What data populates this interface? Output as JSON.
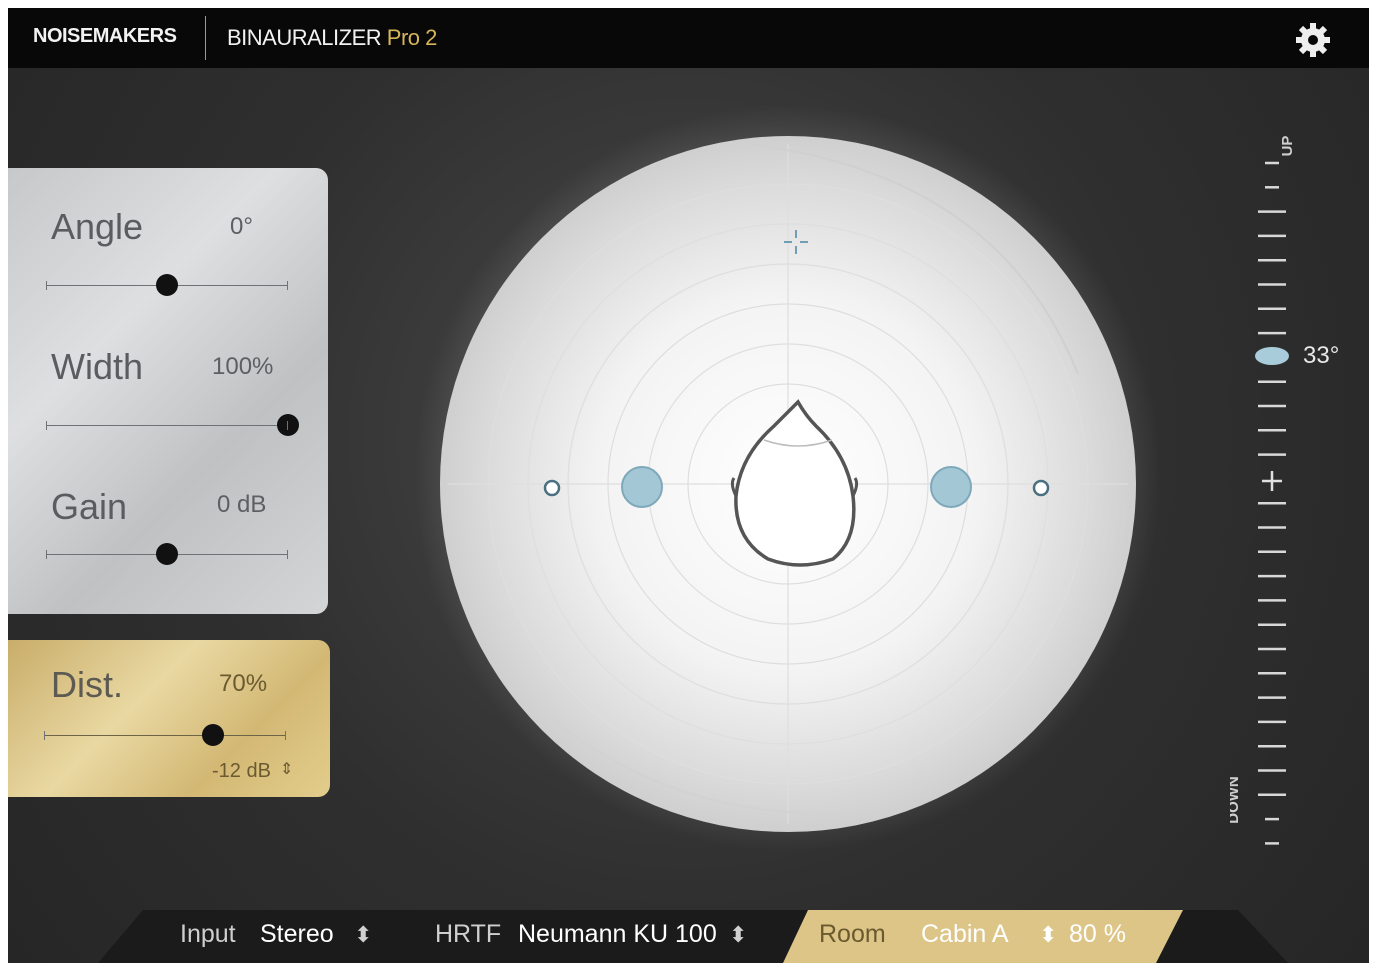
{
  "header": {
    "brand": "NOISEMAKERS",
    "product": "BINAURALIZER",
    "product_suffix": "Pro 2",
    "settings_icon": "gear-icon"
  },
  "controls": [
    {
      "label": "Angle",
      "value": "0°",
      "position": 0.5
    },
    {
      "label": "Width",
      "value": "100%",
      "position": 1.0
    },
    {
      "label": "Gain",
      "value": "0 dB",
      "position": 0.5
    }
  ],
  "distance": {
    "label": "Dist.",
    "value": "70%",
    "position": 0.7,
    "sub_value": "-12 dB",
    "sub_icon": "updown-arrow-icon"
  },
  "elevation": {
    "up_label": "UP",
    "down_label": "DOWN",
    "value": "33°"
  },
  "bottom": {
    "input_label": "Input",
    "input_value": "Stereo",
    "hrtf_label": "HRTF",
    "hrtf_value": "Neumann KU 100",
    "room_label": "Room",
    "room_value": "Cabin A",
    "room_amount": "80 %"
  },
  "colors": {
    "accent_gold": "#d8b55a",
    "source_blue": "#9fc3d3",
    "dark_bg": "#2f2f2f"
  }
}
